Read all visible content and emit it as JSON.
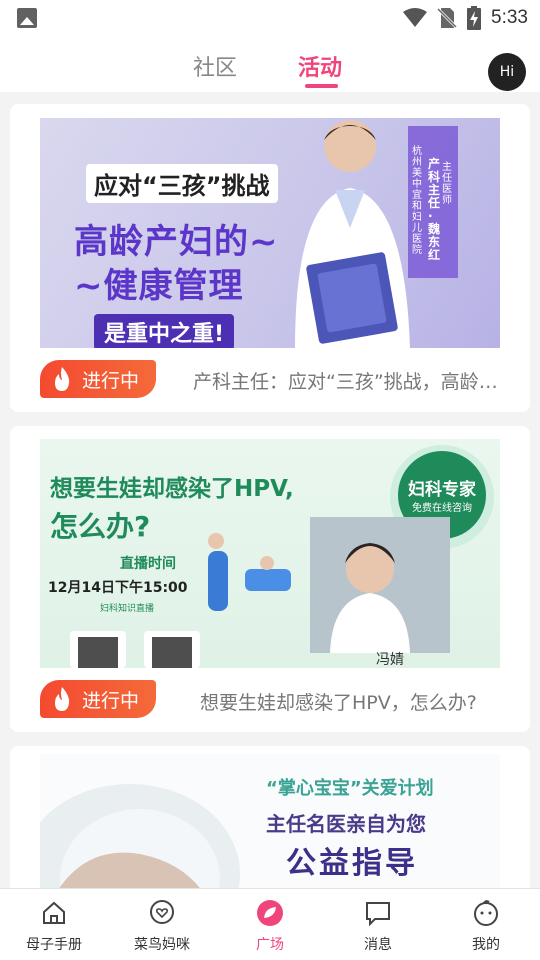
{
  "status_bar": {
    "time": "5:33"
  },
  "top_tabs": {
    "community": "社区",
    "activity": "活动",
    "avatar_text": "Hi"
  },
  "cards": [
    {
      "status": "进行中",
      "title": "产科主任：应对“三孩”挑战，高龄产妇的健康管理",
      "banner": {
        "headline": "应对“三孩”挑战",
        "line1": "高龄产妇的~",
        "line2": "~健康管理",
        "line3": "是重中之重!",
        "doctor_col1": "杭州美中宜和妇儿医院",
        "doctor_col2": "产科主任·魏东红",
        "doctor_col3": "主任医师"
      }
    },
    {
      "status": "进行中",
      "title": "想要生娃却感染了HPV，怎么办?",
      "banner": {
        "headline1": "想要生娃却感染了HPV,",
        "headline2": "怎么办?",
        "badge_line1": "妇科专家",
        "badge_line2": "免费在线咨询",
        "live_label": "直播时间",
        "live_time": "12月14日下午15:00",
        "small_note": "妇科知识直播",
        "doctor_name": "冯婧"
      }
    },
    {
      "banner": {
        "line1": "“掌心宝宝”关爱计划",
        "line2": "主任名医亲自为您",
        "line3": "公益指导"
      }
    }
  ],
  "bottom_nav": [
    {
      "label": "母子手册",
      "icon": "home-icon"
    },
    {
      "label": "菜鸟妈咪",
      "icon": "heart-bubble-icon"
    },
    {
      "label": "广场",
      "icon": "leaf-icon",
      "active": true
    },
    {
      "label": "消息",
      "icon": "message-icon"
    },
    {
      "label": "我的",
      "icon": "face-icon"
    }
  ],
  "colors": {
    "accent": "#f0457a",
    "status_pill": "#f44a30",
    "brand_purple": "#6b3fcf",
    "brand_green": "#1f8a5a"
  }
}
